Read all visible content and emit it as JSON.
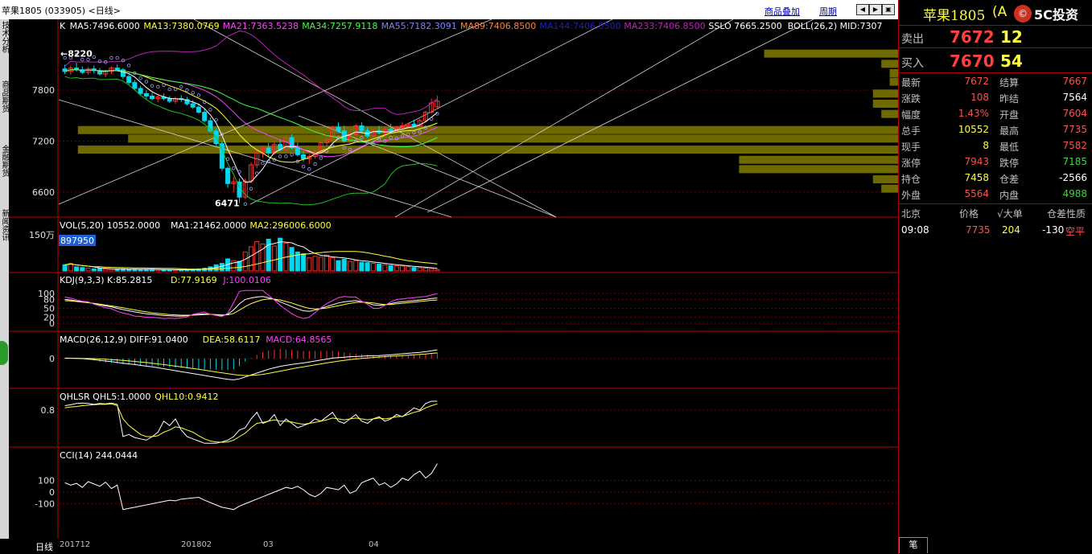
{
  "title_bar": {
    "title": "苹果1805 (033905) <日线>",
    "link_overlay": "商品叠加",
    "link_period": "周期"
  },
  "left_tabs": [
    "技术分析",
    "商品期货",
    "金融期货",
    "新闻资讯"
  ],
  "bottom_tab": "日线",
  "colors": {
    "up": "#ff3030",
    "down": "#00d8f0",
    "grid": "#a00000",
    "volume_profile": "#6e6a00"
  },
  "main_panel": {
    "indicators": [
      {
        "text": "K",
        "color": "#ffffff"
      },
      {
        "text": "MA5:7496.6000",
        "color": "#ffffff"
      },
      {
        "text": "MA13:7380.0769",
        "color": "#ffff40"
      },
      {
        "text": "MA21:7363.5238",
        "color": "#ff40ff"
      },
      {
        "text": "MA34:7257.9118",
        "color": "#40ff40"
      },
      {
        "text": "MA55:7182.3091",
        "color": "#8080ff"
      },
      {
        "text": "MA89:7406.8500",
        "color": "#ff8040"
      },
      {
        "text": "MA144:7406.8500",
        "color": "#2020c0"
      },
      {
        "text": "MA233:7406.8500",
        "color": "#c020c0"
      },
      {
        "text": "SSLO 7665.2500",
        "color": "#ffffff"
      },
      {
        "text": "BOLL(26,2) MID:7307",
        "color": "#ffffff"
      }
    ],
    "high_label": "←8220",
    "low_label": "6471",
    "y_ticks": [
      "7800",
      "7200",
      "6600"
    ]
  },
  "volume_panel": {
    "indicators": [
      {
        "text": "VOL(5,20) 10552.0000",
        "color": "#ffffff"
      },
      {
        "text": "MA1:21462.0000",
        "color": "#ffffff"
      },
      {
        "text": "MA2:296006.6000",
        "color": "#ffff40"
      }
    ],
    "y_tick": "150万",
    "cursor_value": "897950"
  },
  "kdj_panel": {
    "indicators": [
      {
        "text": "KDJ(9,3,3) K:85.2815",
        "color": "#ffffff"
      },
      {
        "text": "D:77.9169",
        "color": "#ffff40"
      },
      {
        "text": "J:100.0106",
        "color": "#ff40ff"
      }
    ],
    "y_ticks": [
      "100",
      "80",
      "50",
      "20",
      "0"
    ]
  },
  "macd_panel": {
    "indicators": [
      {
        "text": "MACD(26,12,9) DIFF:91.0400",
        "color": "#ffffff"
      },
      {
        "text": "DEA:58.6117",
        "color": "#ffff40"
      },
      {
        "text": "MACD:64.8565",
        "color": "#ff40ff"
      }
    ],
    "y_tick": "0"
  },
  "qhl_panel": {
    "indicators": [
      {
        "text": "QHLSR QHL5:1.0000",
        "color": "#ffffff"
      },
      {
        "text": "QHL10:0.9412",
        "color": "#ffff40"
      }
    ],
    "y_tick": "0.8"
  },
  "cci_panel": {
    "indicators": [
      {
        "text": "CCI(14) 244.0444",
        "color": "#ffffff"
      }
    ],
    "y_ticks": [
      "100",
      "0",
      "-100"
    ]
  },
  "x_axis_labels": [
    "201712",
    "201802",
    "03",
    "04"
  ],
  "quote": {
    "name": "苹果1805",
    "code_fragment": "(A",
    "watermark": "5C投资",
    "ask_label": "卖出",
    "ask_price": "7672",
    "ask_vol": "12",
    "bid_label": "买入",
    "bid_price": "7670",
    "bid_vol": "54",
    "rows": [
      {
        "l1": "最新",
        "v1": "7672",
        "c1": "red",
        "l2": "结算",
        "v2": "7667",
        "c2": "red"
      },
      {
        "l1": "涨跌",
        "v1": "108",
        "c1": "red",
        "l2": "昨结",
        "v2": "7564",
        "c2": "white"
      },
      {
        "l1": "幅度",
        "v1": "1.43%",
        "c1": "red",
        "l2": "开盘",
        "v2": "7604",
        "c2": "red"
      },
      {
        "l1": "总手",
        "v1": "10552",
        "c1": "yellow",
        "l2": "最高",
        "v2": "7735",
        "c2": "red"
      },
      {
        "l1": "现手",
        "v1": "8",
        "c1": "yellow",
        "l2": "最低",
        "v2": "7582",
        "c2": "red"
      },
      {
        "l1": "涨停",
        "v1": "7943",
        "c1": "red",
        "l2": "跌停",
        "v2": "7185",
        "c2": "green"
      },
      {
        "l1": "持仓",
        "v1": "7458",
        "c1": "yellow",
        "l2": "仓差",
        "v2": "-2566",
        "c2": "white"
      },
      {
        "l1": "外盘",
        "v1": "5564",
        "c1": "red",
        "l2": "内盘",
        "v2": "4988",
        "c2": "green"
      }
    ],
    "tick_header": {
      "region": "北京",
      "price": "价格",
      "vol": "√大单",
      "oi": "仓差",
      "nature": "性质"
    },
    "ticks": [
      {
        "time": "09:08",
        "price": "7735",
        "vol": "204",
        "oi": "-130",
        "nature": "空平"
      }
    ],
    "bottom_tab": "笔"
  },
  "chart_data": {
    "type": "candlestick",
    "price_range": [
      6400,
      8350
    ],
    "candles": [
      [
        8050,
        8100,
        7990,
        8020
      ],
      [
        8020,
        8090,
        7980,
        8060
      ],
      [
        8060,
        8120,
        8020,
        8040
      ],
      [
        8040,
        8080,
        7990,
        8010
      ],
      [
        8010,
        8070,
        7980,
        8050
      ],
      [
        8050,
        8090,
        8000,
        8030
      ],
      [
        8030,
        8060,
        7970,
        7990
      ],
      [
        7990,
        8040,
        7950,
        8020
      ],
      [
        8020,
        8080,
        7990,
        8060
      ],
      [
        8060,
        8100,
        8020,
        8040
      ],
      [
        8040,
        8060,
        7930,
        7960
      ],
      [
        7960,
        7990,
        7870,
        7890
      ],
      [
        7890,
        7920,
        7800,
        7820
      ],
      [
        7820,
        7850,
        7740,
        7760
      ],
      [
        7760,
        7800,
        7700,
        7730
      ],
      [
        7730,
        7770,
        7680,
        7700
      ],
      [
        7700,
        7750,
        7660,
        7720
      ],
      [
        7720,
        7760,
        7680,
        7700
      ],
      [
        7700,
        7730,
        7650,
        7670
      ],
      [
        7670,
        7720,
        7640,
        7700
      ],
      [
        7700,
        7740,
        7660,
        7690
      ],
      [
        7690,
        7720,
        7620,
        7640
      ],
      [
        7640,
        7680,
        7580,
        7600
      ],
      [
        7600,
        7640,
        7520,
        7540
      ],
      [
        7540,
        7580,
        7420,
        7440
      ],
      [
        7440,
        7480,
        7300,
        7320
      ],
      [
        7320,
        7350,
        7150,
        7170
      ],
      [
        7170,
        7200,
        6850,
        6880
      ],
      [
        6880,
        6900,
        6650,
        6700
      ],
      [
        6700,
        6780,
        6600,
        6720
      ],
      [
        6720,
        6760,
        6471,
        6540
      ],
      [
        6540,
        6760,
        6520,
        6730
      ],
      [
        6730,
        6950,
        6700,
        6920
      ],
      [
        6920,
        7100,
        6880,
        7060
      ],
      [
        7060,
        7150,
        7000,
        7120
      ],
      [
        7120,
        7180,
        7020,
        7060
      ],
      [
        7060,
        7200,
        7040,
        7160
      ],
      [
        7160,
        7220,
        7080,
        7100
      ],
      [
        7100,
        7260,
        7080,
        7240
      ],
      [
        7240,
        7280,
        7100,
        7120
      ],
      [
        7120,
        7180,
        7020,
        7040
      ],
      [
        7040,
        7080,
        6960,
        6990
      ],
      [
        6990,
        7050,
        6930,
        7020
      ],
      [
        7020,
        7100,
        6990,
        7080
      ],
      [
        7080,
        7200,
        7060,
        7180
      ],
      [
        7180,
        7260,
        7140,
        7220
      ],
      [
        7220,
        7380,
        7200,
        7360
      ],
      [
        7360,
        7420,
        7300,
        7320
      ],
      [
        7320,
        7380,
        7180,
        7200
      ],
      [
        7200,
        7300,
        7160,
        7280
      ],
      [
        7280,
        7400,
        7260,
        7380
      ],
      [
        7380,
        7420,
        7300,
        7320
      ],
      [
        7320,
        7360,
        7240,
        7260
      ],
      [
        7260,
        7340,
        7220,
        7320
      ],
      [
        7320,
        7380,
        7280,
        7300
      ],
      [
        7300,
        7360,
        7260,
        7340
      ],
      [
        7340,
        7400,
        7300,
        7320
      ],
      [
        7320,
        7380,
        7290,
        7360
      ],
      [
        7360,
        7420,
        7320,
        7380
      ],
      [
        7380,
        7420,
        7340,
        7400
      ],
      [
        7400,
        7450,
        7360,
        7380
      ],
      [
        7380,
        7460,
        7370,
        7440
      ],
      [
        7440,
        7560,
        7420,
        7540
      ],
      [
        7540,
        7700,
        7520,
        7650
      ],
      [
        7604,
        7735,
        7582,
        7672
      ]
    ],
    "volume": [
      0.18,
      0.22,
      0.12,
      0.1,
      0.08,
      0.06,
      0.08,
      0.06,
      0.05,
      0.05,
      0.06,
      0.05,
      0.05,
      0.04,
      0.04,
      0.05,
      0.04,
      0.04,
      0.03,
      0.03,
      0.04,
      0.04,
      0.05,
      0.06,
      0.08,
      0.12,
      0.18,
      0.22,
      0.35,
      0.3,
      0.28,
      0.55,
      0.7,
      0.85,
      0.78,
      0.92,
      0.72,
      0.95,
      0.8,
      0.68,
      0.55,
      0.5,
      0.38,
      0.42,
      0.4,
      0.46,
      0.38,
      0.3,
      0.34,
      0.28,
      0.3,
      0.25,
      0.24,
      0.22,
      0.2,
      0.18,
      0.16,
      0.15,
      0.14,
      0.12,
      0.1,
      0.09,
      0.08,
      0.07,
      0.04
    ],
    "kdj": {
      "k": [
        80,
        78,
        75,
        72,
        70,
        66,
        62,
        58,
        55,
        50,
        46,
        42,
        38,
        35,
        32,
        30,
        28,
        26,
        25,
        24,
        24,
        25,
        28,
        30,
        32,
        30,
        28,
        26,
        30,
        45,
        65,
        80,
        85,
        88,
        90,
        86,
        80,
        72,
        64,
        56,
        48,
        42,
        40,
        44,
        50,
        56,
        62,
        68,
        72,
        74,
        76,
        72,
        68,
        62,
        60,
        62,
        66,
        70,
        72,
        74,
        76,
        78,
        80,
        83,
        85
      ],
      "d": [
        76,
        75,
        73,
        71,
        69,
        67,
        64,
        61,
        58,
        55,
        52,
        48,
        45,
        41,
        38,
        35,
        33,
        31,
        29,
        28,
        27,
        27,
        27,
        28,
        29,
        30,
        29,
        28,
        28,
        33,
        44,
        56,
        66,
        73,
        79,
        82,
        81,
        78,
        73,
        68,
        61,
        55,
        50,
        48,
        49,
        51,
        55,
        59,
        63,
        67,
        70,
        71,
        70,
        68,
        65,
        63,
        63,
        65,
        67,
        69,
        71,
        73,
        75,
        77,
        78
      ],
      "j": [
        88,
        84,
        79,
        74,
        72,
        64,
        58,
        52,
        49,
        40,
        34,
        30,
        24,
        23,
        20,
        20,
        18,
        16,
        17,
        16,
        18,
        21,
        30,
        34,
        38,
        30,
        26,
        22,
        34,
        69,
        107,
        128,
        123,
        118,
        112,
        94,
        78,
        60,
        46,
        32,
        22,
        16,
        20,
        36,
        52,
        66,
        76,
        86,
        90,
        88,
        88,
        74,
        64,
        50,
        50,
        60,
        72,
        80,
        82,
        84,
        86,
        88,
        90,
        95,
        100
      ]
    },
    "macd": {
      "diff": [
        5,
        4,
        2,
        0,
        -5,
        -10,
        -18,
        -25,
        -32,
        -40,
        -48,
        -55,
        -62,
        -70,
        -78,
        -86,
        -95,
        -105,
        -115,
        -125,
        -135,
        -145,
        -155,
        -165,
        -175,
        -185,
        -195,
        -205,
        -215,
        -220,
        -210,
        -190,
        -170,
        -150,
        -130,
        -110,
        -95,
        -80,
        -70,
        -60,
        -52,
        -45,
        -35,
        -25,
        -15,
        -5,
        5,
        10,
        15,
        20,
        22,
        25,
        28,
        30,
        32,
        35,
        40,
        45,
        50,
        55,
        60,
        65,
        72,
        82,
        91
      ],
      "dea": [
        3,
        3,
        3,
        2,
        1,
        0,
        -3,
        -6,
        -10,
        -14,
        -19,
        -24,
        -29,
        -35,
        -41,
        -48,
        -55,
        -62,
        -70,
        -78,
        -86,
        -94,
        -103,
        -111,
        -120,
        -129,
        -138,
        -147,
        -156,
        -165,
        -172,
        -175,
        -174,
        -170,
        -163,
        -153,
        -142,
        -130,
        -118,
        -106,
        -95,
        -85,
        -75,
        -65,
        -55,
        -45,
        -35,
        -26,
        -18,
        -10,
        -4,
        2,
        7,
        12,
        16,
        20,
        24,
        28,
        32,
        36,
        40,
        44,
        48,
        54,
        59
      ]
    },
    "qhl": {
      "qhl5": [
        0.9,
        0.92,
        0.95,
        0.96,
        0.95,
        0.93,
        0.95,
        0.94,
        0.96,
        0.93,
        0.2,
        0.25,
        0.18,
        0.15,
        0.12,
        0.2,
        0.3,
        0.55,
        0.45,
        0.6,
        0.35,
        0.2,
        0.15,
        0.1,
        0.05,
        0.05,
        0.05,
        0.08,
        0.12,
        0.2,
        0.35,
        0.4,
        0.6,
        0.75,
        0.5,
        0.55,
        0.7,
        0.45,
        0.6,
        0.5,
        0.4,
        0.45,
        0.5,
        0.6,
        0.55,
        0.65,
        0.75,
        0.55,
        0.5,
        0.6,
        0.7,
        0.55,
        0.5,
        0.6,
        0.65,
        0.55,
        0.6,
        0.7,
        0.65,
        0.75,
        0.85,
        0.8,
        0.95,
        1.0,
        1.0
      ],
      "qhl10": [
        0.85,
        0.87,
        0.88,
        0.9,
        0.91,
        0.92,
        0.93,
        0.93,
        0.94,
        0.9,
        0.6,
        0.45,
        0.35,
        0.25,
        0.2,
        0.2,
        0.22,
        0.3,
        0.35,
        0.42,
        0.4,
        0.35,
        0.3,
        0.22,
        0.15,
        0.1,
        0.08,
        0.07,
        0.08,
        0.12,
        0.2,
        0.28,
        0.4,
        0.5,
        0.52,
        0.55,
        0.58,
        0.55,
        0.55,
        0.53,
        0.5,
        0.48,
        0.5,
        0.52,
        0.55,
        0.58,
        0.62,
        0.6,
        0.58,
        0.6,
        0.62,
        0.6,
        0.58,
        0.6,
        0.62,
        0.6,
        0.62,
        0.65,
        0.66,
        0.7,
        0.75,
        0.78,
        0.85,
        0.9,
        0.94
      ]
    },
    "cci": [
      80,
      60,
      75,
      40,
      90,
      70,
      50,
      85,
      30,
      60,
      -150,
      -140,
      -130,
      -120,
      -110,
      -100,
      -90,
      -80,
      -70,
      -75,
      -60,
      -55,
      -50,
      -45,
      -70,
      -90,
      -110,
      -130,
      -140,
      -150,
      -120,
      -100,
      -80,
      -60,
      -40,
      -20,
      0,
      20,
      40,
      30,
      50,
      20,
      -20,
      -40,
      -10,
      40,
      30,
      20,
      60,
      -10,
      10,
      80,
      100,
      120,
      60,
      80,
      40,
      70,
      120,
      100,
      150,
      180,
      120,
      160,
      244
    ]
  }
}
